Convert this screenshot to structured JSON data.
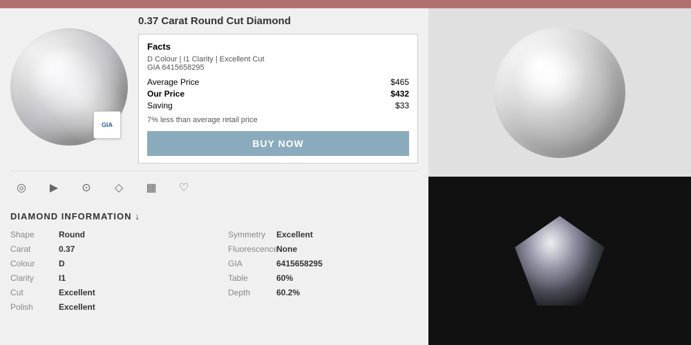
{
  "topBar": {},
  "product": {
    "title": "0.37 Carat Round Cut Diamond",
    "facts": {
      "title": "Facts",
      "description": "D Colour | I1 Clarity | Excellent Cut",
      "gia": "GIA 6415658295",
      "averagePriceLabel": "Average Price",
      "averagePrice": "$465",
      "ourPriceLabel": "Our Price",
      "ourPrice": "$432",
      "savingLabel": "Saving",
      "saving": "$33",
      "percentNote": "7% less than average retail price"
    },
    "buyButton": "BUY NOW",
    "giaBadgeText": "GIA"
  },
  "icons": [
    {
      "name": "diamond-360-icon",
      "symbol": "◎"
    },
    {
      "name": "play-icon",
      "symbol": "▶"
    },
    {
      "name": "certificate-icon",
      "symbol": "⊙"
    },
    {
      "name": "diamond-icon",
      "symbol": "◇"
    },
    {
      "name": "bar-chart-icon",
      "symbol": "▦"
    },
    {
      "name": "heart-icon",
      "symbol": "♡"
    }
  ],
  "diamondInfo": {
    "sectionTitle": "DIAMOND INFORMATION",
    "sectionArrow": "↓",
    "leftFields": [
      {
        "label": "Shape",
        "value": "Round"
      },
      {
        "label": "Carat",
        "value": "0.37"
      },
      {
        "label": "Colour",
        "value": "D"
      },
      {
        "label": "Clarity",
        "value": "I1"
      },
      {
        "label": "Cut",
        "value": "Excellent"
      },
      {
        "label": "Polish",
        "value": "Excellent"
      }
    ],
    "rightFields": [
      {
        "label": "Symmetry",
        "value": "Excellent"
      },
      {
        "label": "Fluorescence",
        "value": "None"
      },
      {
        "label": "GIA",
        "value": "6415658295"
      },
      {
        "label": "Table",
        "value": "60%"
      },
      {
        "label": "Depth",
        "value": "60.2%"
      }
    ]
  }
}
